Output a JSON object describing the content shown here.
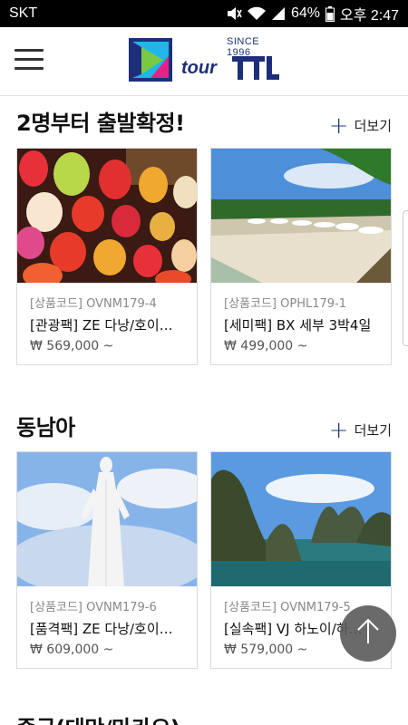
{
  "status_bar": {
    "carrier": "SKT",
    "battery": "64%",
    "time": "오후 2:47"
  },
  "header": {
    "logo_since": "SINCE 1996",
    "logo_word": "tour",
    "logo_brand": "TTL"
  },
  "sections": [
    {
      "title": "2명부터 출발확정!",
      "more_label": "더보기",
      "cards": [
        {
          "code": "[상품코드] OVNM179-4",
          "name": "[관광팩] ZE 다낭/호이…",
          "price": "₩ 569,000 ~"
        },
        {
          "code": "[상품코드] OPHL179-1",
          "name": "[세미팩] BX 세부 3박4일",
          "price": "₩ 499,000 ~"
        }
      ]
    },
    {
      "title": "동남아",
      "more_label": "더보기",
      "cards": [
        {
          "code": "[상품코드] OVNM179-6",
          "name": "[품격팩] ZE 다낭/호이…",
          "price": "₩ 609,000 ~"
        },
        {
          "code": "[상품코드] OVNM179-5",
          "name": "[실속팩] VJ 하노이/하…",
          "price": "₩ 579,000 ~"
        }
      ]
    },
    {
      "title": "중국(대만/마카오)"
    }
  ],
  "icons": {
    "menu": "hamburger-icon",
    "more": "plus-icon",
    "scroll_top": "arrow-up-icon"
  },
  "colors": {
    "brand_navy": "#1d2f7a",
    "plus_blue": "#1d3a7a",
    "fab_gray": "#5a5a5a"
  }
}
